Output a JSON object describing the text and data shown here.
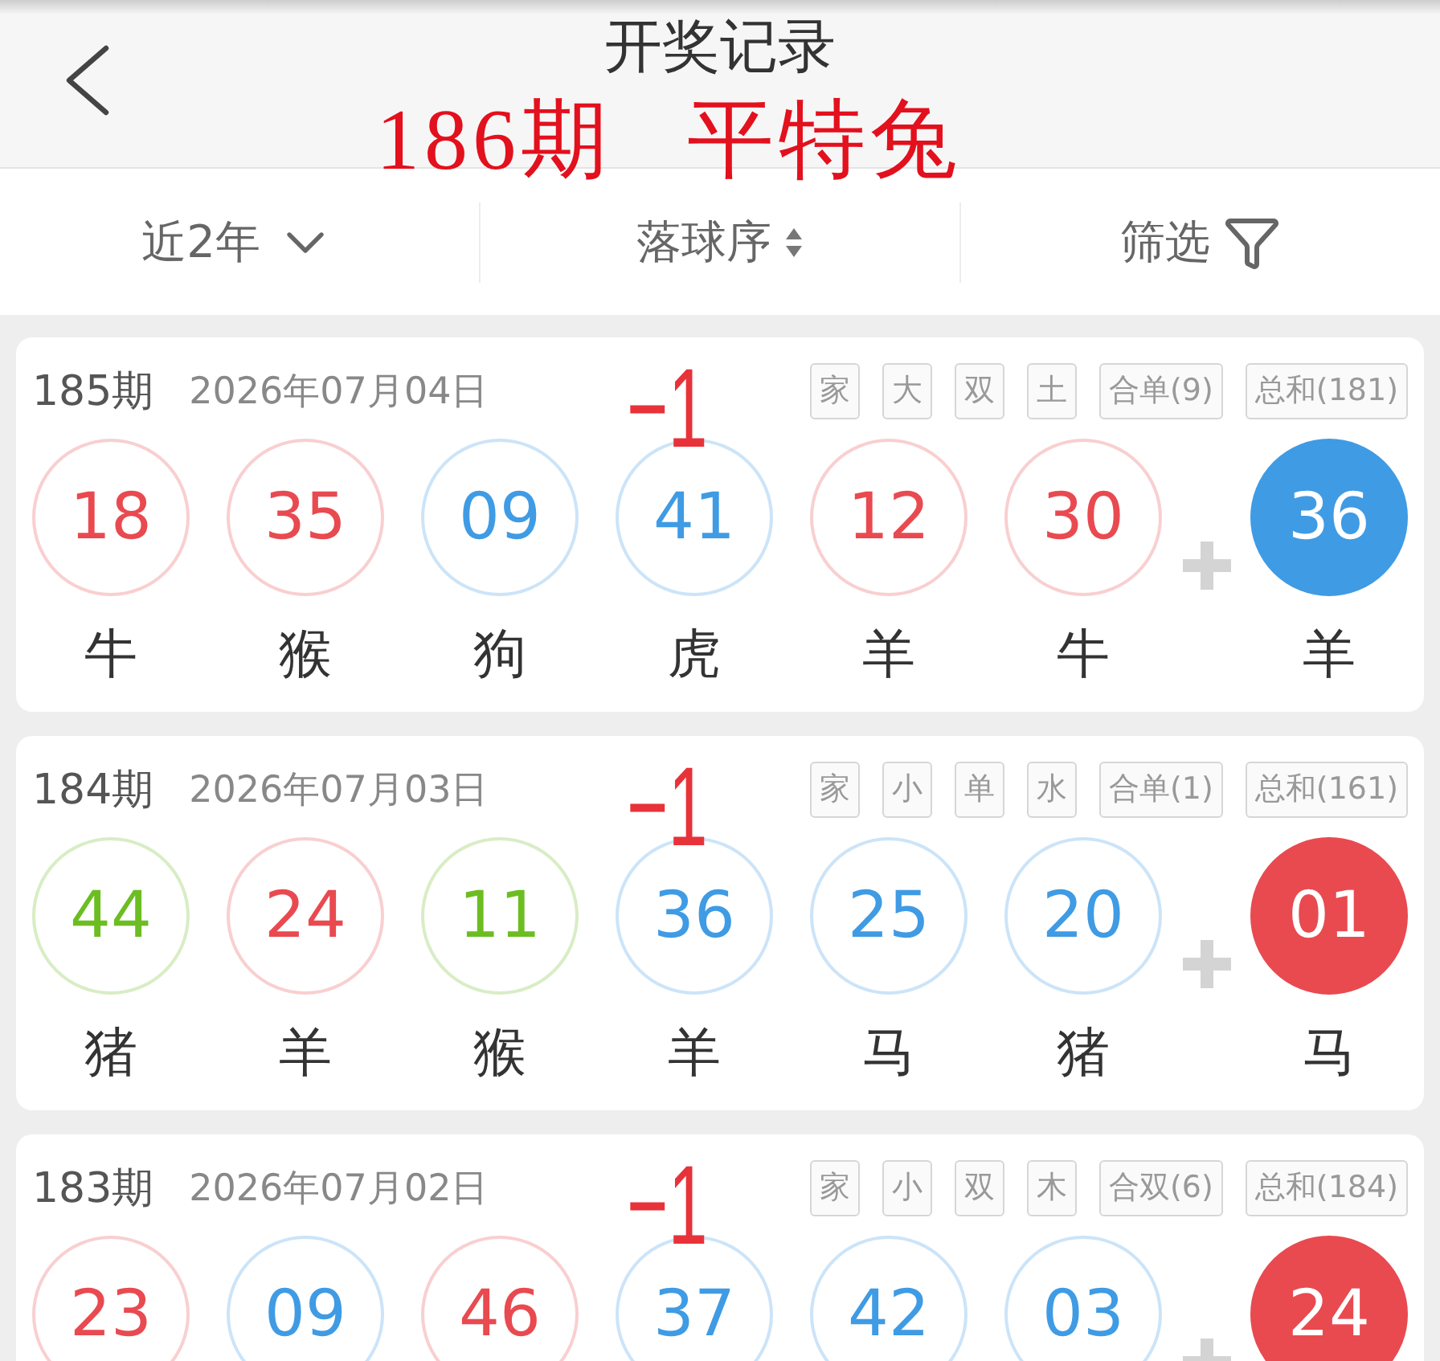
{
  "header": {
    "title": "开奖记录",
    "overlay_note": "186期 平特兔"
  },
  "filters": [
    {
      "kind": "dropdown",
      "label": "近2年"
    },
    {
      "kind": "sort",
      "label": "落球序"
    },
    {
      "kind": "filter",
      "label": "筛选"
    }
  ],
  "draws": [
    {
      "issue": "185期",
      "date": "2026年07月04日",
      "mark": "−1",
      "tags": [
        "家",
        "大",
        "双",
        "土",
        "合单(9)",
        "总和(181)"
      ],
      "numbers": [
        {
          "number": "18",
          "zodiac": "牛",
          "color": "#e84a50"
        },
        {
          "number": "35",
          "zodiac": "猴",
          "color": "#e84a50"
        },
        {
          "number": "09",
          "zodiac": "狗",
          "color": "#3f9be4"
        },
        {
          "number": "41",
          "zodiac": "虎",
          "color": "#3f9be4"
        },
        {
          "number": "12",
          "zodiac": "羊",
          "color": "#e84a50"
        },
        {
          "number": "30",
          "zodiac": "牛",
          "color": "#e84a50"
        }
      ],
      "special": {
        "number": "36",
        "zodiac": "羊",
        "color": "#3f9be4"
      }
    },
    {
      "issue": "184期",
      "date": "2026年07月03日",
      "mark": "−1",
      "tags": [
        "家",
        "小",
        "单",
        "水",
        "合单(1)",
        "总和(161)"
      ],
      "numbers": [
        {
          "number": "44",
          "zodiac": "猪",
          "color": "#6cbd22"
        },
        {
          "number": "24",
          "zodiac": "羊",
          "color": "#e84a50"
        },
        {
          "number": "11",
          "zodiac": "猴",
          "color": "#6cbd22"
        },
        {
          "number": "36",
          "zodiac": "羊",
          "color": "#3f9be4"
        },
        {
          "number": "25",
          "zodiac": "马",
          "color": "#3f9be4"
        },
        {
          "number": "20",
          "zodiac": "猪",
          "color": "#3f9be4"
        }
      ],
      "special": {
        "number": "01",
        "zodiac": "马",
        "color": "#e84a50"
      }
    },
    {
      "issue": "183期",
      "date": "2026年07月02日",
      "mark": "−1",
      "tags": [
        "家",
        "小",
        "双",
        "木",
        "合双(6)",
        "总和(184)"
      ],
      "numbers": [
        {
          "number": "23",
          "color": "#e84a50"
        },
        {
          "number": "09",
          "color": "#3f9be4"
        },
        {
          "number": "46",
          "color": "#e84a50"
        },
        {
          "number": "37",
          "color": "#3f9be4"
        },
        {
          "number": "42",
          "color": "#3f9be4"
        },
        {
          "number": "03",
          "color": "#3f9be4"
        }
      ],
      "special": {
        "number": "24",
        "color": "#e84a50"
      }
    }
  ]
}
